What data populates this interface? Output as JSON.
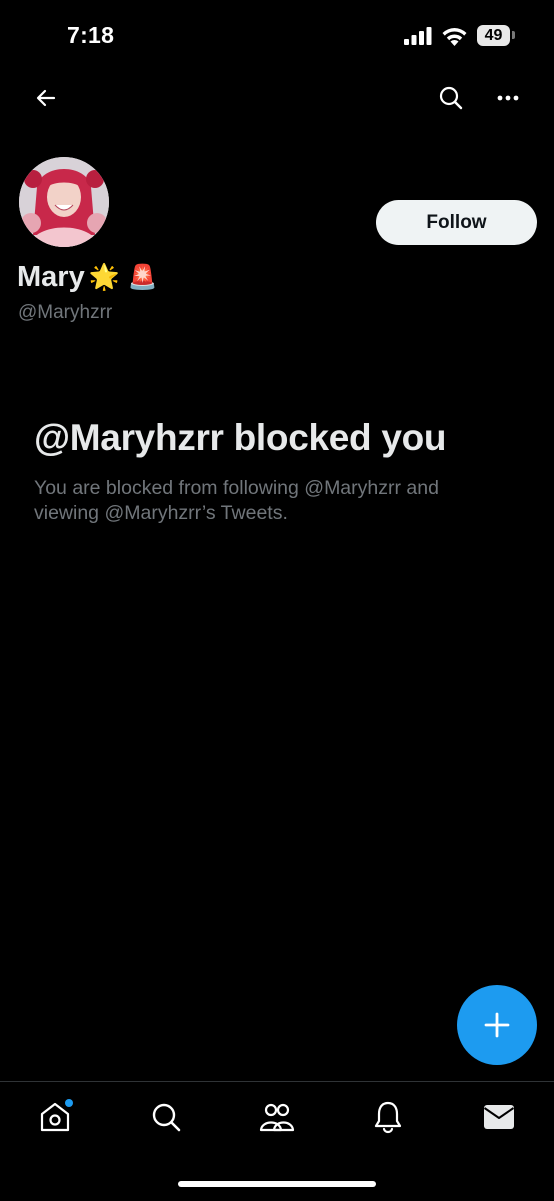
{
  "status_bar": {
    "time": "7:18",
    "battery": "49"
  },
  "profile": {
    "name": "Mary",
    "name_emojis": [
      "🌟",
      "🚨"
    ],
    "handle": "@Maryhzrr",
    "follow_label": "Follow"
  },
  "blocked": {
    "title": "@Maryhzrr blocked you",
    "description": "You are blocked from following @Maryhzrr and viewing @Maryhzrr’s Tweets."
  },
  "tabs": [
    "home",
    "search",
    "communities",
    "notifications",
    "messages"
  ],
  "icons": {
    "back": "back-arrow-icon",
    "search": "search-icon",
    "more": "more-icon",
    "compose": "plus-icon"
  },
  "colors": {
    "accent": "#1d9bf0",
    "background": "#000000",
    "muted": "#71767b"
  }
}
